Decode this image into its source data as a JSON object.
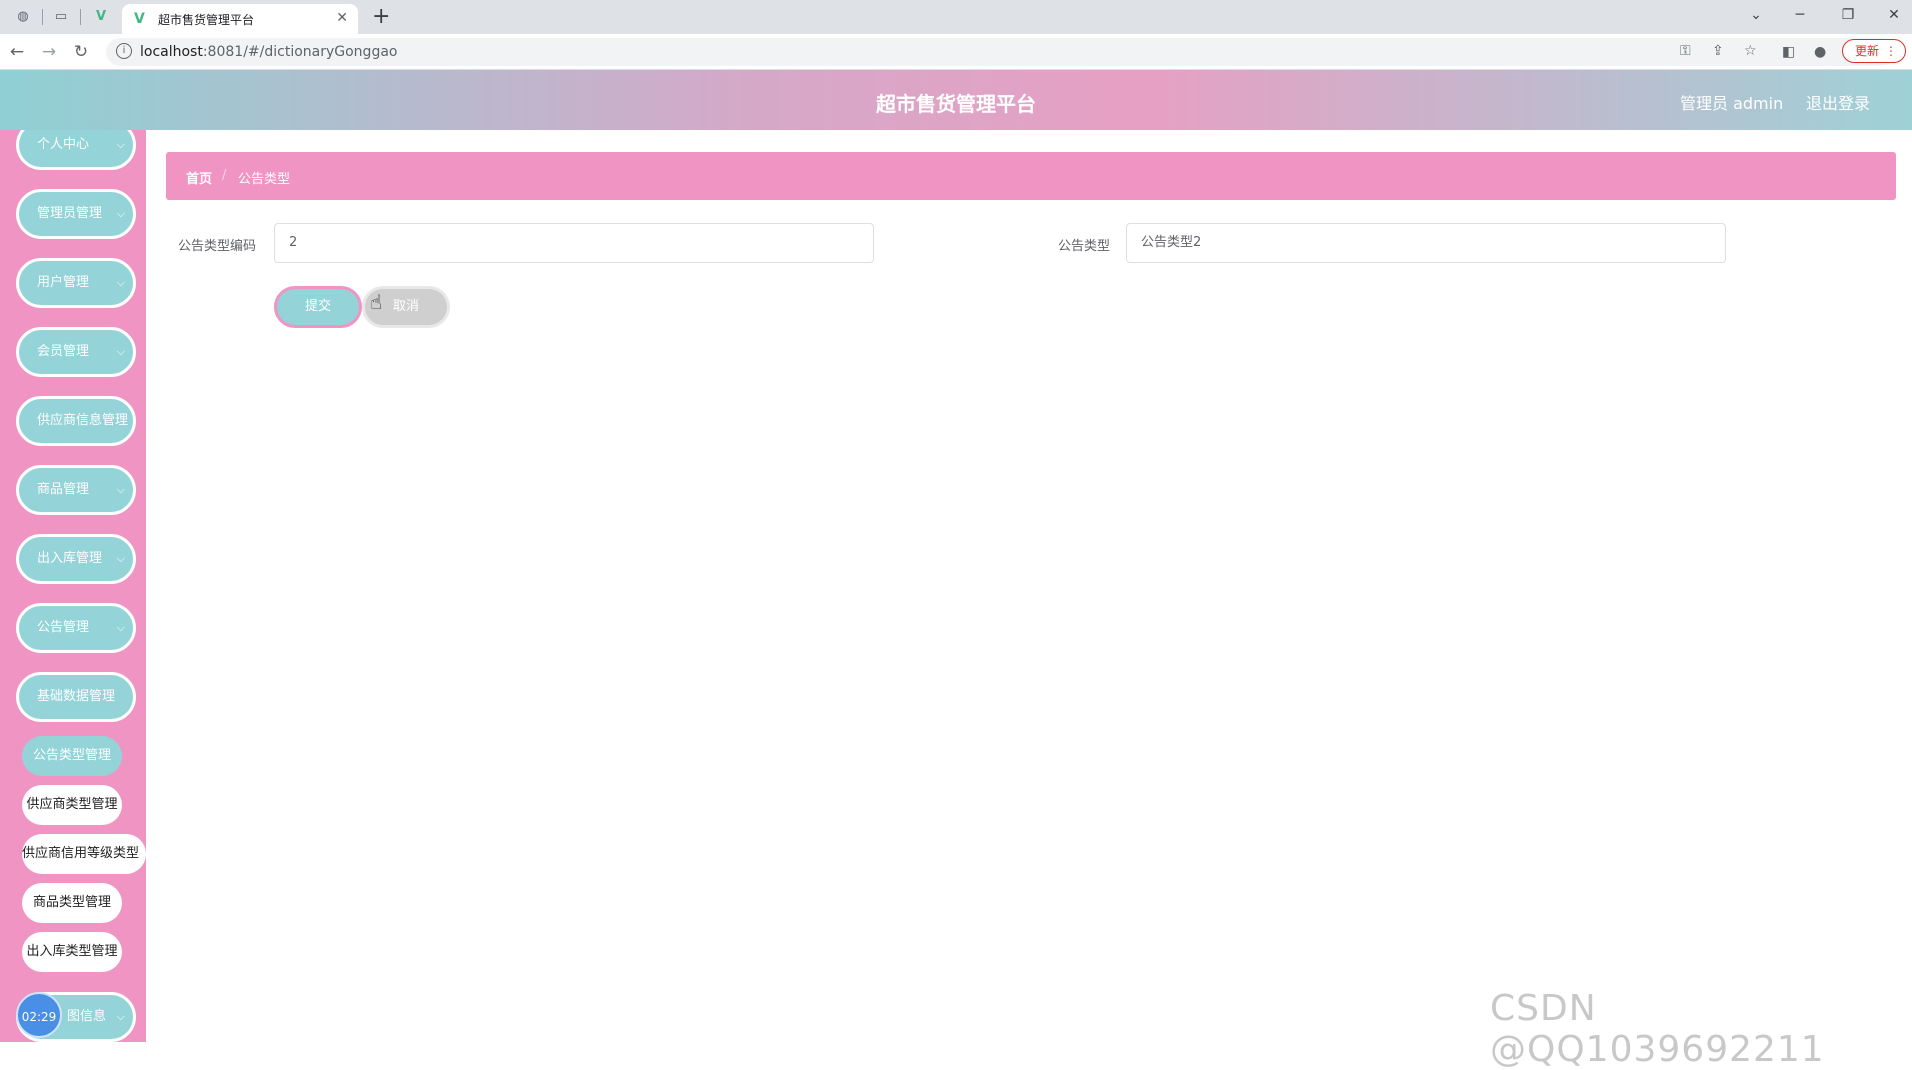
{
  "browser": {
    "tab_title": "超市售货管理平台",
    "url_host": "localhost",
    "url_rest": ":8081/#/dictionaryGonggao",
    "update_label": "更新"
  },
  "header": {
    "title": "超市售货管理平台",
    "user_label": "管理员 admin",
    "logout_label": "退出登录"
  },
  "sidebar": {
    "menu": [
      {
        "label": "个人中心"
      },
      {
        "label": "管理员管理"
      },
      {
        "label": "用户管理"
      },
      {
        "label": "会员管理"
      },
      {
        "label": "供应商信息管理"
      },
      {
        "label": "商品管理"
      },
      {
        "label": "出入库管理"
      },
      {
        "label": "公告管理"
      },
      {
        "label": "基础数据管理"
      }
    ],
    "submenu": [
      {
        "label": "公告类型管理",
        "active": true
      },
      {
        "label": "供应商类型管理"
      },
      {
        "label": "供应商信用等级类型"
      },
      {
        "label": "商品类型管理"
      },
      {
        "label": "出入库类型管理"
      }
    ],
    "last_menu_partial": "图信息",
    "timer": "02:29"
  },
  "breadcrumb": {
    "home": "首页",
    "separator": "/",
    "current": "公告类型"
  },
  "form": {
    "code_label": "公告类型编码",
    "code_value": "2",
    "type_label": "公告类型",
    "type_value": "公告类型2",
    "submit_label": "提交",
    "cancel_label": "取消"
  },
  "watermark": "CSDN @QQ1039692211",
  "colors": {
    "accent_teal": "#94d3d8",
    "accent_pink": "#ef94c3"
  }
}
